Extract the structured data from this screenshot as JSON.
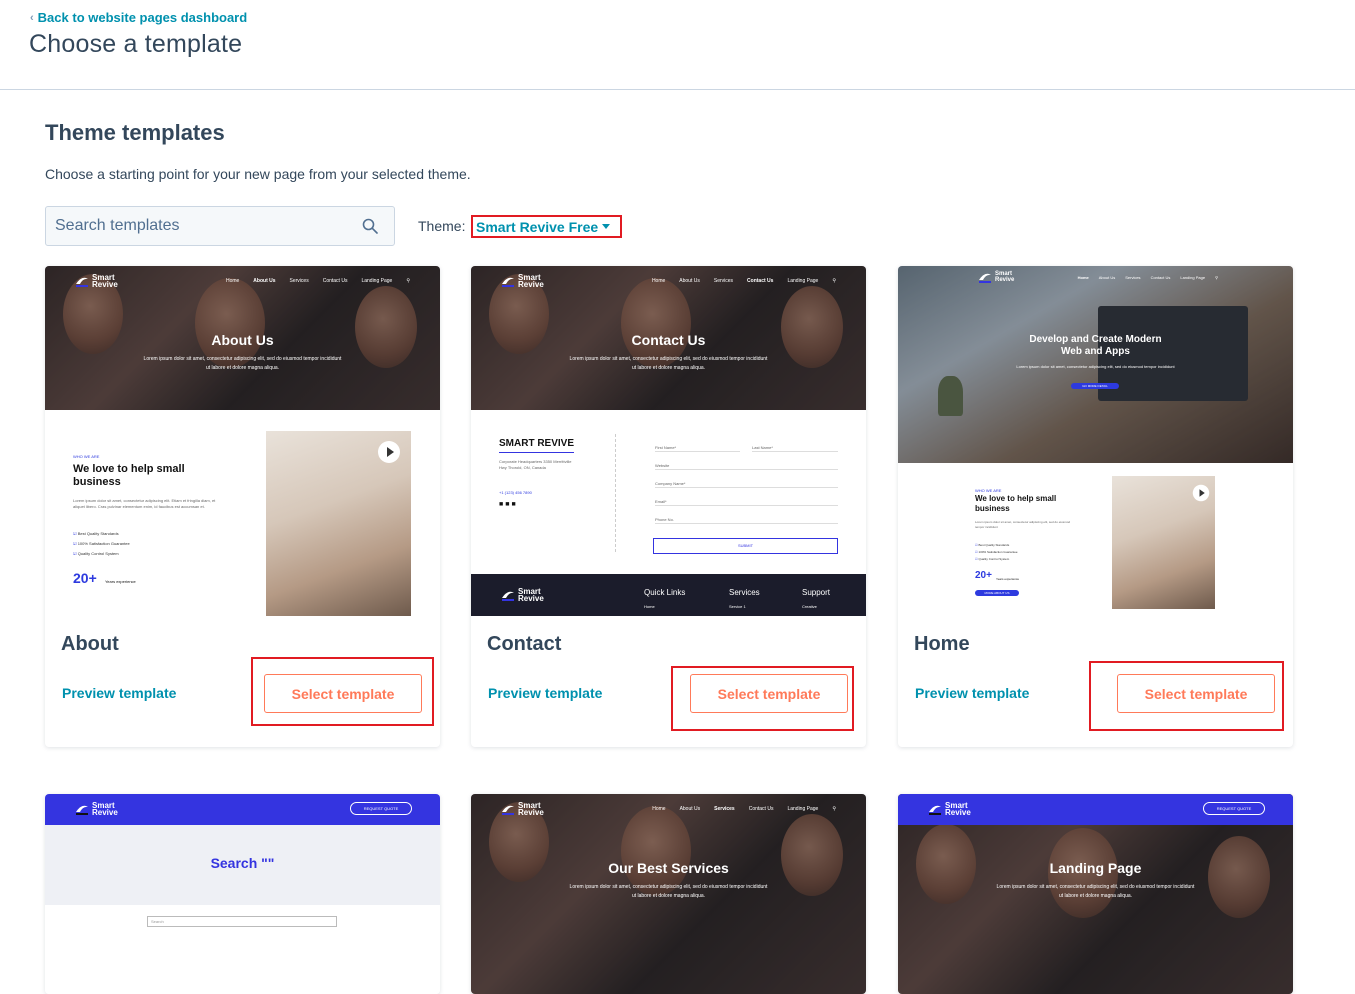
{
  "header": {
    "back_link": "Back to website pages dashboard",
    "title": "Choose a template"
  },
  "section": {
    "title": "Theme templates",
    "subtitle": "Choose a starting point for your new page from your selected theme.",
    "search_placeholder": "Search templates",
    "theme_label": "Theme:",
    "theme_value": "Smart Revive Free"
  },
  "logo_text": [
    "Smart",
    "Revive"
  ],
  "nav_items": {
    "about": [
      "Home",
      "About Us",
      "Services",
      "Contact Us",
      "Landing Page"
    ],
    "contact": [
      "Home",
      "About Us",
      "Services",
      "Contact Us",
      "Landing Page"
    ],
    "home": [
      "Home",
      "About Us",
      "Services",
      "Contact Us",
      "Landing Page"
    ],
    "services": [
      "Home",
      "About Us",
      "Services",
      "Contact Us",
      "Landing Page"
    ]
  },
  "lorem": "Lorem ipsum dolor sit amet, consectetur adipiscing elit, sed do eiusmod tempor incididunt",
  "lorem2": "ut labore et dolore magna aliqua.",
  "cards": [
    {
      "name": "About",
      "preview": "Preview template",
      "select": "Select template",
      "thumb": {
        "hero_title": "About Us",
        "eyebrow": "WHO WE ARE",
        "heading": "We love to help small business",
        "body": "Lorem ipsum dolor sit amet, consectetur adipiscing elit. Etiam et fringilla diam, et aliquet libero. Cras pulvinar elementum enim, id faucibus est accumsan et.",
        "bullets": [
          "Best Quality Standards",
          "100% Satisfaction Guarantee",
          "Quality Control System"
        ],
        "stat": "20+",
        "stat_label": "Years experience"
      }
    },
    {
      "name": "Contact",
      "preview": "Preview template",
      "select": "Select template",
      "thumb": {
        "hero_title": "Contact Us",
        "company": "SMART REVIVE",
        "address": "Corporate Headquarters 3350 Merrittville Hwy Thorold, ON, Canada",
        "phone": "+1 (123) 456 7890",
        "fields": [
          "First Name*",
          "Last Name*",
          "Website",
          "Company Name*",
          "Email*",
          "Phone No."
        ],
        "submit": "SUBMIT",
        "footer_cols": [
          "Quick Links",
          "Services",
          "Support"
        ],
        "footer_sub": [
          "Home",
          "Service 1",
          "Creative"
        ]
      }
    },
    {
      "name": "Home",
      "preview": "Preview template",
      "select": "Select template",
      "thumb": {
        "hero_title": "Develop and Create Modern Web and Apps",
        "hero_button": "GO MORE DETAIL",
        "eyebrow": "WHO WE ARE",
        "heading": "We love to help small business",
        "bullets": [
          "Best Quality Standards",
          "100% Satisfaction Guarantee",
          "Quality Control System"
        ],
        "stat": "20+",
        "stat_label": "Years experience",
        "button": "MORE ABOUT US"
      }
    },
    {
      "thumb": {
        "quote_button": "REQUEST QUOTE",
        "hero_title": "Search \"\"",
        "search_placeholder": "Search"
      }
    },
    {
      "thumb": {
        "hero_title": "Our Best Services"
      }
    },
    {
      "thumb": {
        "quote_button": "REQUEST QUOTE",
        "hero_title": "Landing Page"
      }
    }
  ],
  "colors": {
    "link": "#0091ae",
    "cta": "#ff7a59",
    "highlight": "#e11b22",
    "text": "#33475b",
    "brand_purple": "#3434e0"
  }
}
